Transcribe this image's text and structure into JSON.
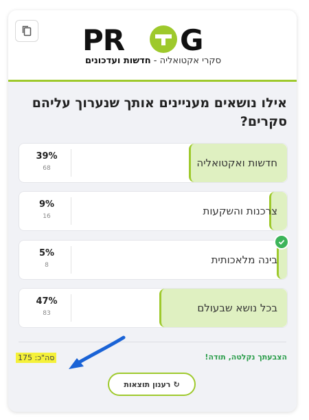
{
  "header": {
    "logo_text": "PROG",
    "tagline_prefix": "סקרי אקטואליה - ",
    "tagline_bold": "חדשות ועדכונים"
  },
  "poll": {
    "question": "אילו נושאים מעניינים אותך שנערוך עליהם סקרים?",
    "options": [
      {
        "label": "חדשות ואקטואליה",
        "percent_label": "39%",
        "percent": 39,
        "count": "68",
        "selected": false
      },
      {
        "label": "צרכנות והשקעות",
        "percent_label": "9%",
        "percent": 9,
        "count": "16",
        "selected": false
      },
      {
        "label": "בינה מלאכותית",
        "percent_label": "5%",
        "percent": 5,
        "count": "8",
        "selected": true
      },
      {
        "label": "בכל נושא שבעולם",
        "percent_label": "47%",
        "percent": 47,
        "count": "83",
        "selected": false
      }
    ],
    "thanks_text": "הצבעתך נקלטה, תודה!",
    "total_text": "סה\"כ: 175",
    "refresh_label": "רענון תוצאות",
    "refresh_icon": "↻"
  },
  "colors": {
    "accent": "#9ec92c",
    "fill": "#dff0c1",
    "success": "#2a9d4a",
    "highlight": "#f5f13a",
    "arrow": "#1a63d6"
  }
}
